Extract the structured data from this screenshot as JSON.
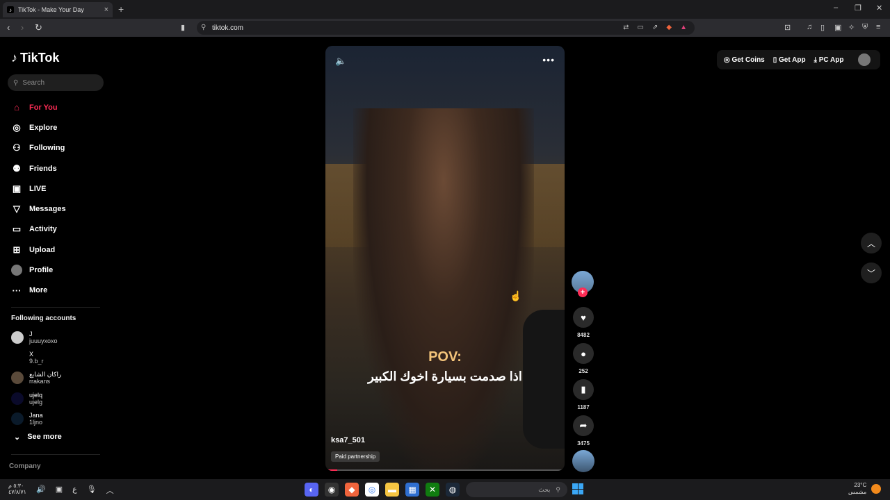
{
  "browser": {
    "tab_title": "TikTok - Make Your Day",
    "tab_close": "×",
    "new_tab": "+",
    "url": "tiktok.com",
    "window_controls": [
      "–",
      "❐",
      "✕"
    ]
  },
  "sidebar": {
    "logo": "TikTok",
    "search_placeholder": "Search",
    "nav": [
      {
        "label": "For You",
        "icon": "home-icon"
      },
      {
        "label": "Explore",
        "icon": "compass-icon"
      },
      {
        "label": "Following",
        "icon": "following-icon"
      },
      {
        "label": "Friends",
        "icon": "friends-icon"
      },
      {
        "label": "LIVE",
        "icon": "live-icon"
      },
      {
        "label": "Messages",
        "icon": "messages-icon"
      },
      {
        "label": "Activity",
        "icon": "activity-icon"
      },
      {
        "label": "Upload",
        "icon": "upload-icon"
      },
      {
        "label": "Profile",
        "icon": "profile-avatar"
      },
      {
        "label": "More",
        "icon": "more-icon"
      }
    ],
    "following_title": "Following accounts",
    "accounts": [
      {
        "name": "J",
        "handle": "juuuyxoxo"
      },
      {
        "name": "X",
        "handle": "9.b_r"
      },
      {
        "name": "راكان الشايع",
        "handle": "rrakans"
      },
      {
        "name": "ujelq",
        "handle": "ujelg"
      },
      {
        "name": "Jana",
        "handle": "1ljno"
      }
    ],
    "see_more": "See more",
    "company": "Company"
  },
  "video": {
    "caption_pov": "POV:",
    "caption_ar": "اذا صدمت بسيارة اخوك الكبير",
    "username": "ksa7_501",
    "paid": "Paid partnership",
    "progress": 0.05
  },
  "actions": {
    "likes": "8482",
    "comments": "252",
    "saves": "1187",
    "shares": "3475"
  },
  "topright": {
    "coins": "Get Coins",
    "app": "Get App",
    "pc": "PC App"
  },
  "taskbar": {
    "time": "٥:٣٠ م",
    "date": "٤٧/٨/٧١",
    "search": "بحث",
    "temp": "23°C",
    "weather": "مشمس"
  }
}
